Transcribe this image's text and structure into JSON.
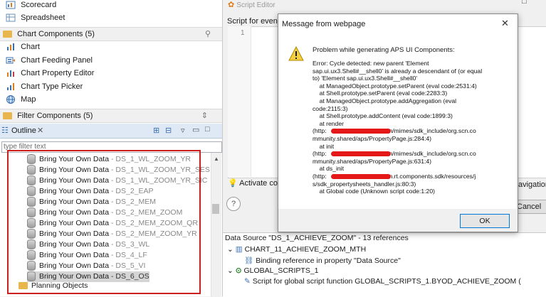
{
  "components": {
    "top_items": [
      {
        "label": "Scorecard",
        "icon": "scorecard-icon"
      },
      {
        "label": "Spreadsheet",
        "icon": "spreadsheet-icon"
      }
    ],
    "chart_components_header": "Chart Components (5)",
    "chart_items": [
      {
        "label": "Chart",
        "icon": "chart-icon"
      },
      {
        "label": "Chart Feeding Panel",
        "icon": "feeding-panel-icon"
      },
      {
        "label": "Chart Property Editor",
        "icon": "property-editor-icon"
      },
      {
        "label": "Chart Type Picker",
        "icon": "type-picker-icon"
      },
      {
        "label": "Map",
        "icon": "globe-icon"
      }
    ],
    "filter_components_header": "Filter Components (5)"
  },
  "outline": {
    "title": "Outline",
    "filter_placeholder": "type filter text",
    "rows": [
      {
        "name": "Bring Your Own Data",
        "source": " - DS_1_WL_ZOOM_YR"
      },
      {
        "name": "Bring Your Own Data",
        "source": " - DS_1_WL_ZOOM_YR_SES"
      },
      {
        "name": "Bring Your Own Data",
        "source": " - DS_1_WL_ZOOM_YR_SIC"
      },
      {
        "name": "Bring Your Own Data",
        "source": " - DS_2_EAP"
      },
      {
        "name": "Bring Your Own Data",
        "source": " - DS_2_MEM"
      },
      {
        "name": "Bring Your Own Data",
        "source": " - DS_2_MEM_ZOOM"
      },
      {
        "name": "Bring Your Own Data",
        "source": " - DS_2_MEM_ZOOM_QR"
      },
      {
        "name": "Bring Your Own Data",
        "source": " - DS_2_MEM_ZOOM_YR"
      },
      {
        "name": "Bring Your Own Data",
        "source": " - DS_3_WL"
      },
      {
        "name": "Bring Your Own Data",
        "source": " - DS_4_LF"
      },
      {
        "name": "Bring Your Own Data",
        "source": " - DS_5_VI"
      },
      {
        "name": "Bring Your Own Data",
        "source": " - DS_6_OS",
        "selected": true
      }
    ],
    "planning_objects": "Planning Objects"
  },
  "script_editor": {
    "title": "Script Editor",
    "script_for_event": "Script for event",
    "line_number": "1",
    "activate_label": "Activate co",
    "navigation_label": "avigation",
    "cancel_label": "Cancel",
    "help_symbol": "?"
  },
  "references": {
    "header": "Data Source \"DS_1_ACHIEVE_ZOOM\" - 13 references",
    "items": [
      "CHART_11_ACHIEVE_ZOOM_MTH",
      "Binding reference in property \"Data Source\"",
      "GLOBAL_SCRIPTS_1",
      "Script for global script function GLOBAL_SCRIPTS_1.BYOD_ACHIEVE_ZOOM ("
    ]
  },
  "dialog": {
    "title": "Message from webpage",
    "heading": "Problem while generating APS UI Components:",
    "message": "Error: Cycle detected: new parent 'Element\nsap.ui.ux3.Shell#__shell0' is already a descendant of (or equal\nto) 'Element sap.ui.ux3.Shell#__shell0'\n    at ManagedObject.prototype.setParent (eval code:2531:4)\n    at Shell.prototype.setParent (eval code:2283:3)\n    at ManagedObject.prototype.addAggregation (eval\ncode:2115:3)\n    at Shell.prototype.addContent (eval code:1899:3)\n    at render\n(http:                         /aad/zen/mimes/sdk_include/org.scn.co\nmmunity.shared/aps/PropertyPage.js:284:4)\n    at init\n(http:                         /aad/zen/mimes/sdk_include/org.scn.co\nmmunity.shared/aps/PropertyPage.js:631:4)\n    at ds_init\n(http:                         /aad/zen.rt.components.sdk/resources/j\ns/sdk_propertysheets_handler.js:80:3)\n    at Global code (Unknown script code:1:20)",
    "ok_label": "OK",
    "icon": "warning-icon"
  }
}
